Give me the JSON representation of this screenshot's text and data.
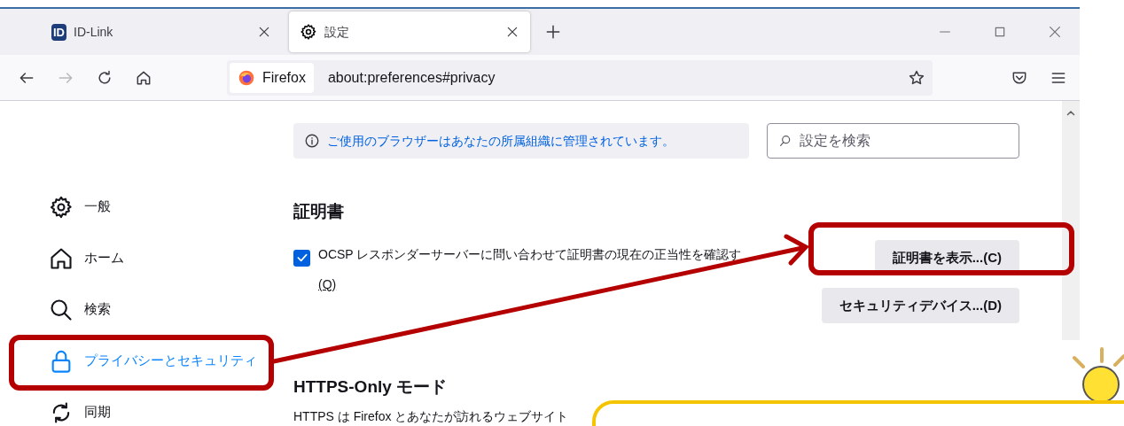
{
  "tabs": [
    {
      "title": "ID-Link",
      "kind": "logo",
      "logo_text": "ID",
      "selected": false
    },
    {
      "title": "設定",
      "kind": "settings",
      "selected": true
    }
  ],
  "nav_buttons": [
    {
      "kind": "back",
      "disabled": false
    },
    {
      "kind": "forward",
      "disabled": true
    },
    {
      "kind": "reload",
      "disabled": false
    },
    {
      "kind": "home",
      "disabled": false
    }
  ],
  "address_bar": {
    "identity": "Firefox",
    "url": "about:preferences#privacy"
  },
  "sidebar": {
    "items": [
      {
        "label": "一般",
        "kind": "gear",
        "selected": false
      },
      {
        "label": "ホーム",
        "kind": "home",
        "selected": false
      },
      {
        "label": "検索",
        "kind": "search",
        "selected": false
      },
      {
        "label": "プライバシーとセキュリティ",
        "kind": "lock",
        "selected": true
      },
      {
        "label": "同期",
        "kind": "sync",
        "selected": false
      }
    ]
  },
  "notice": "ご使用のブラウザーはあなたの所属組織に管理されています。",
  "search": {
    "placeholder": "設定を検索"
  },
  "certificates": {
    "title": "証明書",
    "checkbox": {
      "label": "OCSP レスポンダーサーバーに問い合わせて証明書の現在の正当性を確認す",
      "label_line_2": "(Q)",
      "checked": true
    },
    "buttons": [
      "証明書を表示...(C)",
      "セキュリティデバイス...(D)"
    ]
  },
  "https_only": {
    "title": "HTTPS-Only モード",
    "text": "HTTPS は Firefox とあなたが訪れるウェブサイト"
  }
}
